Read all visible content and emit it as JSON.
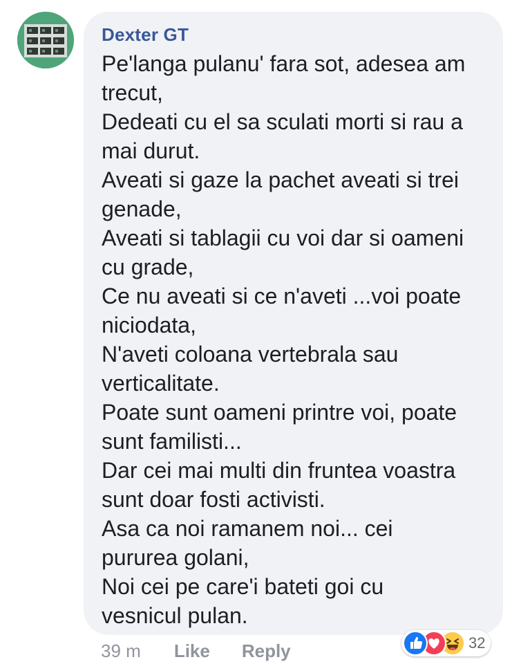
{
  "comment": {
    "author": "Dexter GT",
    "lines": [
      "Pe'langa pulanu' fara sot, adesea am",
      "trecut,",
      "Dedeati cu el sa sculati morti si rau a",
      "mai durut.",
      "Aveati si gaze la pachet aveati si trei",
      "genade,",
      "Aveati si tablagii cu voi dar si oameni",
      "cu grade,",
      "Ce nu aveati si ce n'aveti ...voi poate",
      "niciodata,",
      "N'aveti coloana vertebrala sau",
      "verticalitate.",
      "Poate sunt oameni printre voi, poate",
      "sunt familisti...",
      "Dar cei mai multi din fruntea voastra",
      "sunt doar fosti activisti.",
      "Asa ca noi ramanem noi... cei",
      "pururea golani,",
      "Noi cei pe care'i bateti goi cu",
      "vesnicul pulan."
    ]
  },
  "actions": {
    "timestamp": "39 m",
    "like_label": "Like",
    "reply_label": "Reply"
  },
  "reactions": {
    "icons": [
      "like-icon",
      "love-icon",
      "haha-icon"
    ],
    "count": "32"
  },
  "colors": {
    "author": "#385898",
    "bubble": "#f1f2f6",
    "text": "#1c1e21",
    "muted": "#90949c",
    "like": "#1877f2",
    "love": "#f33e58",
    "haha": "#fdcb4b"
  }
}
